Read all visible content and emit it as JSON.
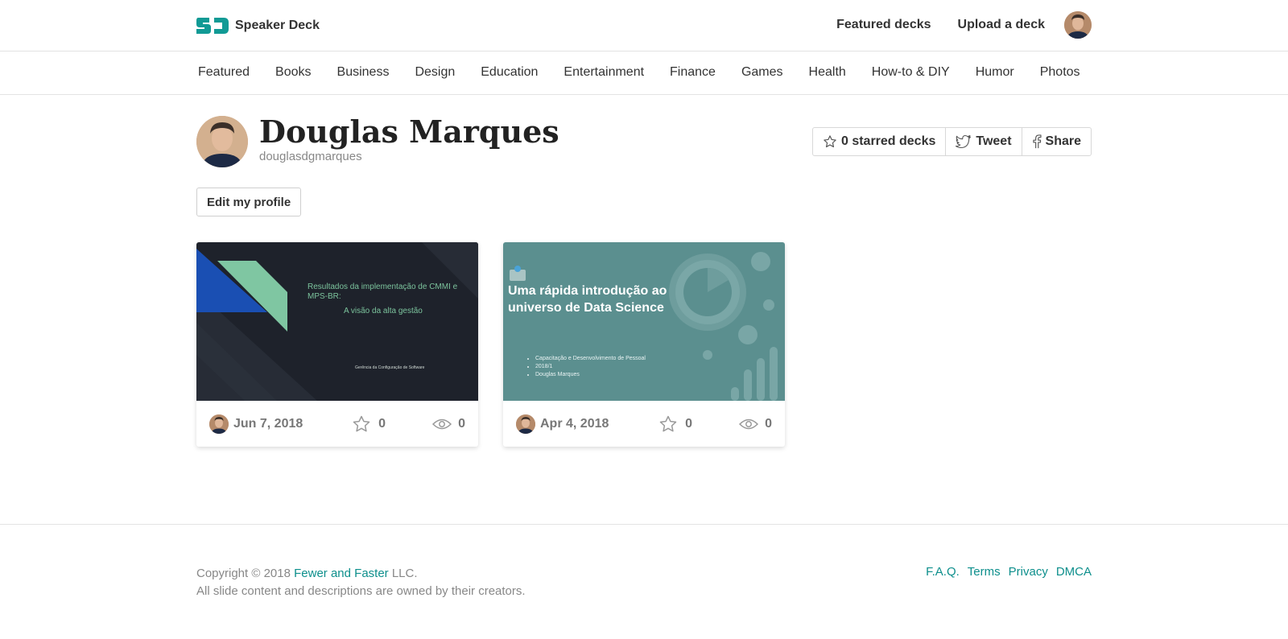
{
  "brand": {
    "name": "Speaker Deck",
    "accent": "#119a95"
  },
  "topnav": {
    "featured_decks": "Featured decks",
    "upload_deck": "Upload a deck"
  },
  "categories": [
    "Featured",
    "Books",
    "Business",
    "Design",
    "Education",
    "Entertainment",
    "Finance",
    "Games",
    "Health",
    "How-to & DIY",
    "Humor",
    "Photos"
  ],
  "profile": {
    "name": "Douglas Marques",
    "username": "douglasdgmarques",
    "edit_label": "Edit my profile"
  },
  "actions": {
    "starred": "0 starred decks",
    "tweet": "Tweet",
    "share": "Share"
  },
  "decks": [
    {
      "date": "Jun 7, 2018",
      "stars": "0",
      "views": "0",
      "slide_title": "Resultados da implementação de CMMI e MPS-BR:",
      "slide_subtitle": "A visão da alta gestão",
      "slide_footer": "Gerência da Configuração de Software"
    },
    {
      "date": "Apr 4, 2018",
      "stars": "0",
      "views": "0",
      "slide_title": "Uma rápida introdução ao universo de Data Science",
      "slide_bullets": [
        "Capacitação e Desenvolvimento de Pessoal",
        "2018/1",
        "Douglas Marques"
      ]
    }
  ],
  "footer": {
    "copyright_prefix": "Copyright © 2018 ",
    "company_link": "Fewer and Faster",
    "copyright_suffix": " LLC.",
    "line2": "All slide content and descriptions are owned by their creators.",
    "links": [
      "F.A.Q.",
      "Terms",
      "Privacy",
      "DMCA"
    ]
  }
}
